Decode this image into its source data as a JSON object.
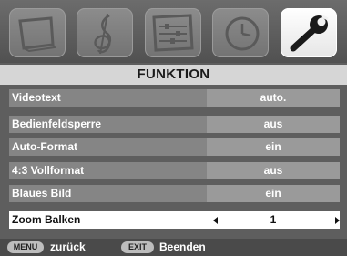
{
  "icons": [
    {
      "name": "picture-icon",
      "active": false
    },
    {
      "name": "sound-icon",
      "active": false
    },
    {
      "name": "settings-sliders-icon",
      "active": false
    },
    {
      "name": "timer-icon",
      "active": false
    },
    {
      "name": "wrench-icon",
      "active": true
    }
  ],
  "menu": {
    "title": "FUNKTION",
    "items": [
      {
        "label": "Videotext",
        "value": "auto."
      },
      {
        "label": "Bedienfeldsperre",
        "value": "aus"
      },
      {
        "label": "Auto-Format",
        "value": "ein"
      },
      {
        "label": "4:3 Vollformat",
        "value": "aus"
      },
      {
        "label": "Blaues Bild",
        "value": "ein"
      },
      {
        "label": "Zoom Balken",
        "value": "1",
        "selected": true
      }
    ]
  },
  "footer": {
    "menu_key": "MENU",
    "menu_text": "zurück",
    "exit_key": "EXIT",
    "exit_text": "Beenden"
  },
  "colors": {
    "background": "#5e5e5e",
    "title_bar": "#d6d6d6",
    "row": "#858585",
    "selected_row": "#ffffff"
  }
}
